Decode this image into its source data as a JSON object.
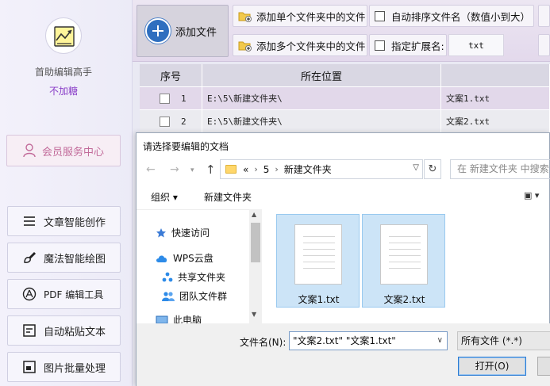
{
  "sidebar": {
    "app_name": "首助编辑高手",
    "tagline": "不加糖",
    "member_button": "会员服务中心",
    "items": [
      {
        "label": "文章智能创作",
        "icon": "lines-icon"
      },
      {
        "label": "魔法智能绘图",
        "icon": "brush-icon"
      },
      {
        "label": "PDF 编辑工具",
        "icon": "pdf-icon"
      },
      {
        "label": "自动粘贴文本",
        "icon": "calendar-icon"
      },
      {
        "label": "图片批量处理",
        "icon": "image-icon"
      }
    ]
  },
  "toolbar": {
    "add_file": "添加文件",
    "add_single_folder": "添加单个文件夹中的文件",
    "add_multi_folder": "添加多个文件夹中的文件",
    "auto_sort": "自动排序文件名（数值小到大）",
    "specify_ext": "指定扩展名:",
    "ext_value": "txt"
  },
  "table": {
    "headers": [
      "序号",
      "所在位置",
      ""
    ],
    "rows": [
      {
        "num": "1",
        "location": "E:\\5\\新建文件夹\\",
        "name": "文案1.txt"
      },
      {
        "num": "2",
        "location": "E:\\5\\新建文件夹\\",
        "name": "文案2.txt"
      }
    ]
  },
  "dialog": {
    "title": "请选择要编辑的文档",
    "breadcrumb": [
      "«",
      "5",
      "新建文件夹"
    ],
    "search_placeholder": "在 新建文件夹 中搜索",
    "organize": "组织 ▾",
    "new_folder": "新建文件夹",
    "nav_items": [
      {
        "label": "快速访问",
        "icon": "star-icon"
      },
      {
        "label": "WPS云盘",
        "icon": "cloud-icon"
      },
      {
        "label": "共享文件夹",
        "icon": "share-icon"
      },
      {
        "label": "团队文件群",
        "icon": "team-icon"
      },
      {
        "label": "此电脑",
        "icon": "computer-icon"
      }
    ],
    "files": [
      "文案1.txt",
      "文案2.txt"
    ],
    "filename_label": "文件名(N):",
    "filename_value": "\"文案2.txt\" \"文案1.txt\"",
    "filetype": "所有文件 (*.*)",
    "open_button": "打开(O)"
  },
  "colors": {
    "tagline": "#8a3fc8",
    "member": "#c26b9a",
    "selection": "#cce4f7",
    "accent": "#2f6fbf"
  }
}
